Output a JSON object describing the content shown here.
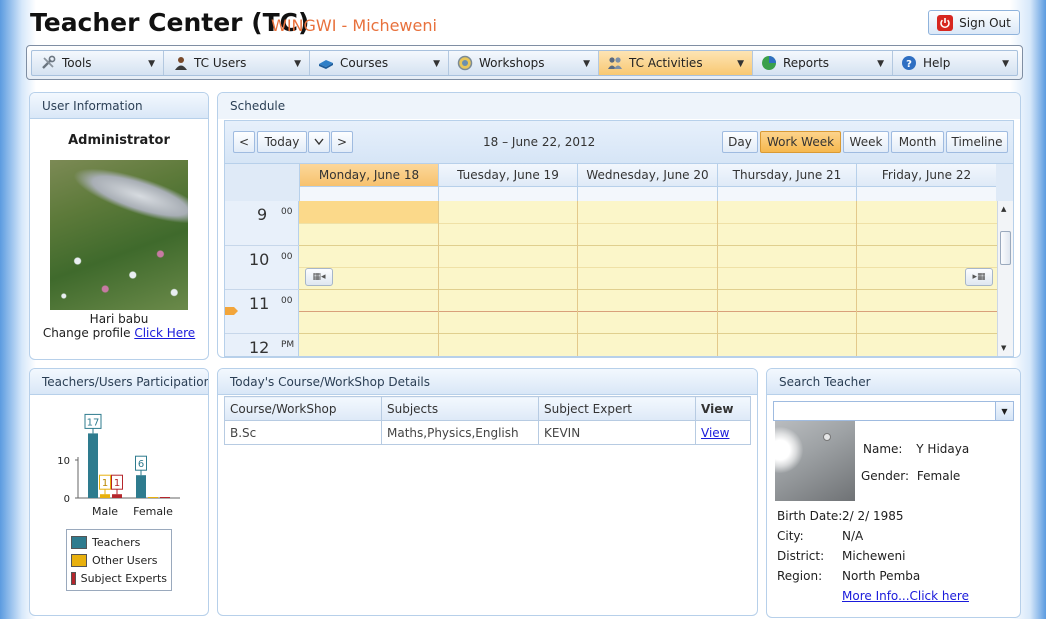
{
  "header": {
    "title": "Teacher Center (TC)",
    "subtitle": "WINGWI - Micheweni",
    "signout_label": "Sign Out"
  },
  "menu": [
    {
      "label": "Tools",
      "icon": "tools-icon"
    },
    {
      "label": "TC Users",
      "icon": "users-icon"
    },
    {
      "label": "Courses",
      "icon": "book-icon"
    },
    {
      "label": "Workshops",
      "icon": "workshop-icon"
    },
    {
      "label": "TC Activities",
      "icon": "activities-icon",
      "active": true
    },
    {
      "label": "Reports",
      "icon": "reports-icon"
    },
    {
      "label": "Help",
      "icon": "help-icon"
    }
  ],
  "user_info": {
    "panel_title": "User Information",
    "role": "Administrator",
    "name": "Hari babu",
    "change_profile_text": "Change profile",
    "change_profile_link": "Click Here"
  },
  "schedule": {
    "panel_title": "Schedule",
    "today_label": "Today",
    "range_label": "18 – June 22, 2012",
    "views": [
      "Day",
      "Work Week",
      "Week",
      "Month",
      "Timeline"
    ],
    "active_view": "Work Week",
    "days": [
      "Monday, June 18",
      "Tuesday, June 19",
      "Wednesday, June 20",
      "Thursday, June 21",
      "Friday, June 22"
    ],
    "hours": [
      {
        "h": "9",
        "m": "00"
      },
      {
        "h": "10",
        "m": "00"
      },
      {
        "h": "11",
        "m": "00"
      },
      {
        "h": "12",
        "m": "PM"
      }
    ]
  },
  "participation": {
    "panel_title": "Teachers/Users Participation",
    "chart_data": {
      "type": "bar",
      "categories": [
        "Male",
        "Female"
      ],
      "series": [
        {
          "name": "Teachers",
          "values": [
            17,
            6
          ],
          "color": "#2e7b8e"
        },
        {
          "name": "Other Users",
          "values": [
            1,
            0
          ],
          "color": "#e8b00d"
        },
        {
          "name": "Subject Experts",
          "values": [
            1,
            0
          ],
          "color": "#b5262c"
        }
      ],
      "ylim": [
        0,
        20
      ],
      "yticks": [
        "0",
        "10"
      ],
      "data_labels": [
        "17",
        "1",
        "1",
        "6"
      ],
      "legend": "bottom"
    }
  },
  "course_details": {
    "panel_title": "Today's Course/WorkShop Details",
    "columns": [
      "Course/WorkShop",
      "Subjects",
      "Subject Expert",
      "View"
    ],
    "rows": [
      {
        "course": "B.Sc",
        "subjects": "Maths,Physics,English",
        "expert": "KEVIN",
        "view": "View"
      }
    ]
  },
  "search_teacher": {
    "panel_title": "Search Teacher",
    "name_label": "Name:",
    "name_value": "Y Hidaya",
    "gender_label": "Gender:",
    "gender_value": "Female",
    "birth_label": "Birth Date:",
    "birth_value": "2/ 2/ 1985",
    "city_label": "City:",
    "city_value": "N/A",
    "district_label": "District:",
    "district_value": "Micheweni",
    "region_label": "Region:",
    "region_value": "North Pemba",
    "more_info_link": "More Info...Click here"
  }
}
